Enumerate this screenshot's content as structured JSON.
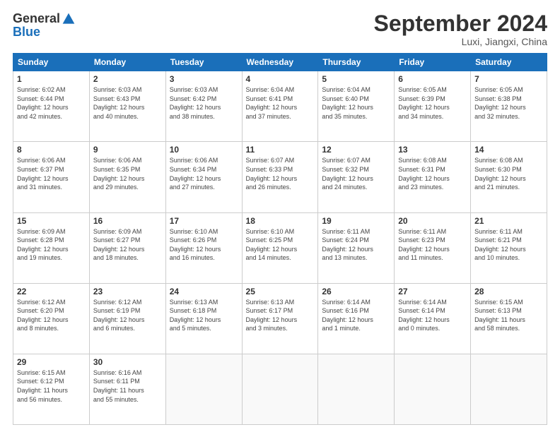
{
  "header": {
    "logo_general": "General",
    "logo_blue": "Blue",
    "month_title": "September 2024",
    "location": "Luxi, Jiangxi, China"
  },
  "weekdays": [
    "Sunday",
    "Monday",
    "Tuesday",
    "Wednesday",
    "Thursday",
    "Friday",
    "Saturday"
  ],
  "weeks": [
    [
      {
        "day": "1",
        "info": "Sunrise: 6:02 AM\nSunset: 6:44 PM\nDaylight: 12 hours\nand 42 minutes."
      },
      {
        "day": "2",
        "info": "Sunrise: 6:03 AM\nSunset: 6:43 PM\nDaylight: 12 hours\nand 40 minutes."
      },
      {
        "day": "3",
        "info": "Sunrise: 6:03 AM\nSunset: 6:42 PM\nDaylight: 12 hours\nand 38 minutes."
      },
      {
        "day": "4",
        "info": "Sunrise: 6:04 AM\nSunset: 6:41 PM\nDaylight: 12 hours\nand 37 minutes."
      },
      {
        "day": "5",
        "info": "Sunrise: 6:04 AM\nSunset: 6:40 PM\nDaylight: 12 hours\nand 35 minutes."
      },
      {
        "day": "6",
        "info": "Sunrise: 6:05 AM\nSunset: 6:39 PM\nDaylight: 12 hours\nand 34 minutes."
      },
      {
        "day": "7",
        "info": "Sunrise: 6:05 AM\nSunset: 6:38 PM\nDaylight: 12 hours\nand 32 minutes."
      }
    ],
    [
      {
        "day": "8",
        "info": "Sunrise: 6:06 AM\nSunset: 6:37 PM\nDaylight: 12 hours\nand 31 minutes."
      },
      {
        "day": "9",
        "info": "Sunrise: 6:06 AM\nSunset: 6:35 PM\nDaylight: 12 hours\nand 29 minutes."
      },
      {
        "day": "10",
        "info": "Sunrise: 6:06 AM\nSunset: 6:34 PM\nDaylight: 12 hours\nand 27 minutes."
      },
      {
        "day": "11",
        "info": "Sunrise: 6:07 AM\nSunset: 6:33 PM\nDaylight: 12 hours\nand 26 minutes."
      },
      {
        "day": "12",
        "info": "Sunrise: 6:07 AM\nSunset: 6:32 PM\nDaylight: 12 hours\nand 24 minutes."
      },
      {
        "day": "13",
        "info": "Sunrise: 6:08 AM\nSunset: 6:31 PM\nDaylight: 12 hours\nand 23 minutes."
      },
      {
        "day": "14",
        "info": "Sunrise: 6:08 AM\nSunset: 6:30 PM\nDaylight: 12 hours\nand 21 minutes."
      }
    ],
    [
      {
        "day": "15",
        "info": "Sunrise: 6:09 AM\nSunset: 6:28 PM\nDaylight: 12 hours\nand 19 minutes."
      },
      {
        "day": "16",
        "info": "Sunrise: 6:09 AM\nSunset: 6:27 PM\nDaylight: 12 hours\nand 18 minutes."
      },
      {
        "day": "17",
        "info": "Sunrise: 6:10 AM\nSunset: 6:26 PM\nDaylight: 12 hours\nand 16 minutes."
      },
      {
        "day": "18",
        "info": "Sunrise: 6:10 AM\nSunset: 6:25 PM\nDaylight: 12 hours\nand 14 minutes."
      },
      {
        "day": "19",
        "info": "Sunrise: 6:11 AM\nSunset: 6:24 PM\nDaylight: 12 hours\nand 13 minutes."
      },
      {
        "day": "20",
        "info": "Sunrise: 6:11 AM\nSunset: 6:23 PM\nDaylight: 12 hours\nand 11 minutes."
      },
      {
        "day": "21",
        "info": "Sunrise: 6:11 AM\nSunset: 6:21 PM\nDaylight: 12 hours\nand 10 minutes."
      }
    ],
    [
      {
        "day": "22",
        "info": "Sunrise: 6:12 AM\nSunset: 6:20 PM\nDaylight: 12 hours\nand 8 minutes."
      },
      {
        "day": "23",
        "info": "Sunrise: 6:12 AM\nSunset: 6:19 PM\nDaylight: 12 hours\nand 6 minutes."
      },
      {
        "day": "24",
        "info": "Sunrise: 6:13 AM\nSunset: 6:18 PM\nDaylight: 12 hours\nand 5 minutes."
      },
      {
        "day": "25",
        "info": "Sunrise: 6:13 AM\nSunset: 6:17 PM\nDaylight: 12 hours\nand 3 minutes."
      },
      {
        "day": "26",
        "info": "Sunrise: 6:14 AM\nSunset: 6:16 PM\nDaylight: 12 hours\nand 1 minute."
      },
      {
        "day": "27",
        "info": "Sunrise: 6:14 AM\nSunset: 6:14 PM\nDaylight: 12 hours\nand 0 minutes."
      },
      {
        "day": "28",
        "info": "Sunrise: 6:15 AM\nSunset: 6:13 PM\nDaylight: 11 hours\nand 58 minutes."
      }
    ],
    [
      {
        "day": "29",
        "info": "Sunrise: 6:15 AM\nSunset: 6:12 PM\nDaylight: 11 hours\nand 56 minutes."
      },
      {
        "day": "30",
        "info": "Sunrise: 6:16 AM\nSunset: 6:11 PM\nDaylight: 11 hours\nand 55 minutes."
      },
      {
        "day": "",
        "info": ""
      },
      {
        "day": "",
        "info": ""
      },
      {
        "day": "",
        "info": ""
      },
      {
        "day": "",
        "info": ""
      },
      {
        "day": "",
        "info": ""
      }
    ]
  ]
}
